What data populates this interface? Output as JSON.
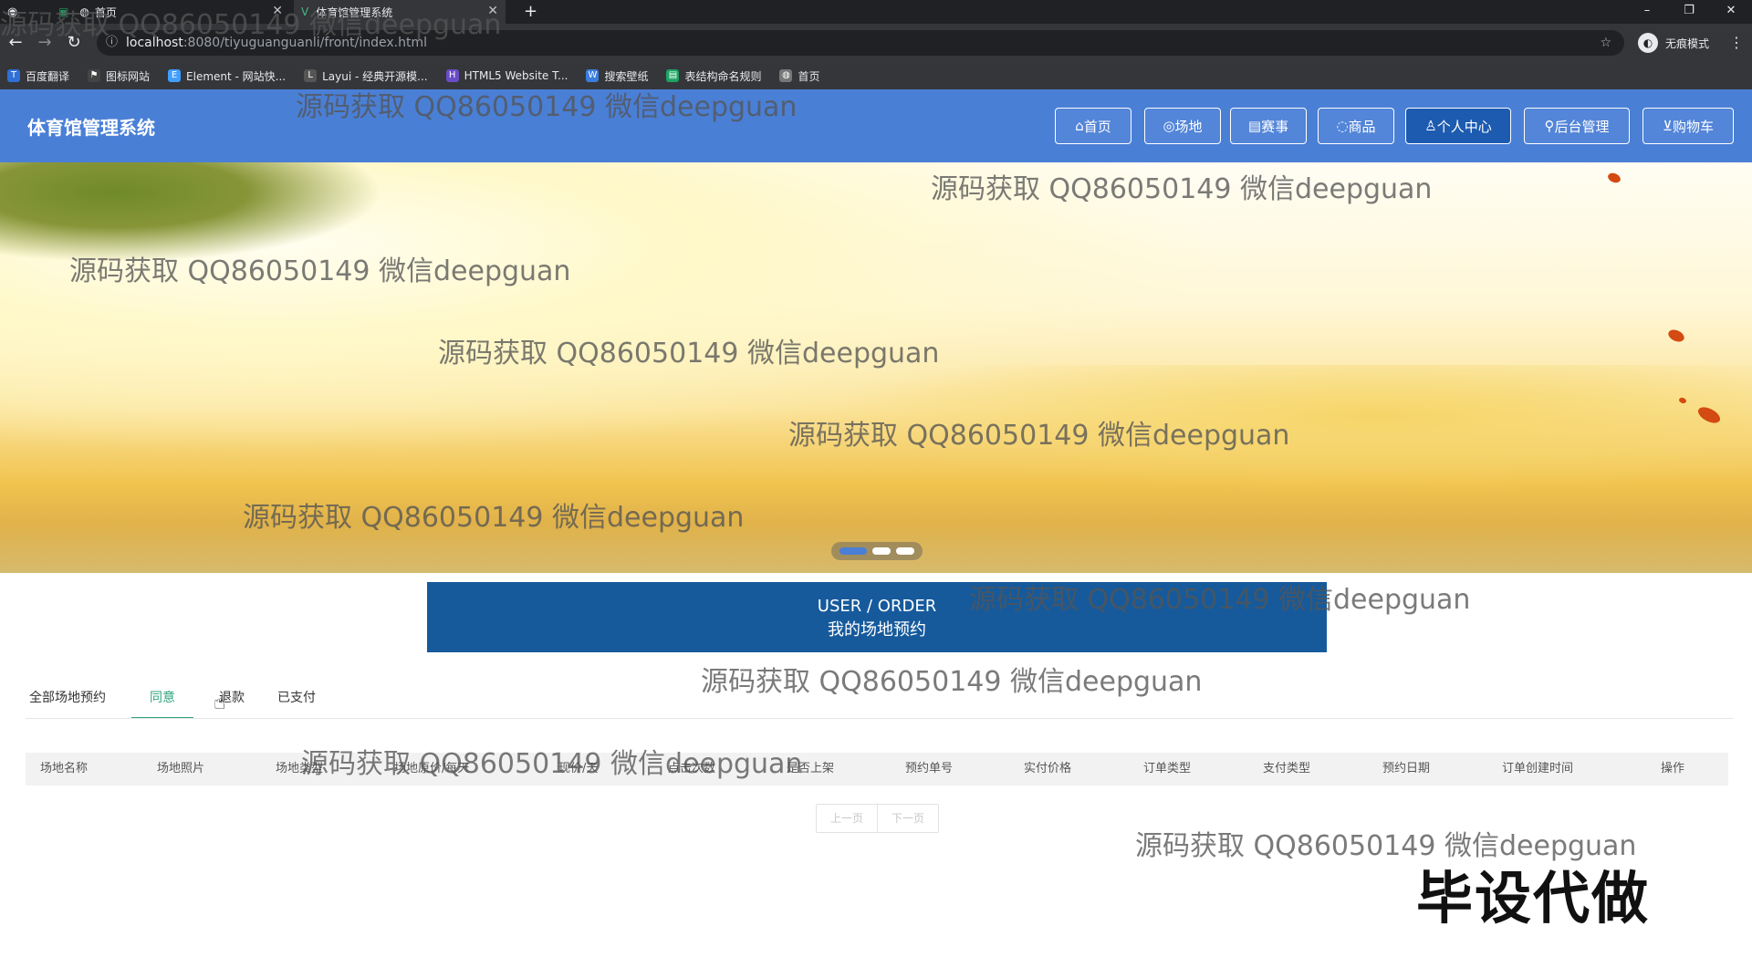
{
  "browser": {
    "tabs": [
      {
        "label": "",
        "icon": "browser-icon"
      },
      {
        "label": "首页",
        "icon": "sheet-icon"
      },
      {
        "label": "体育馆管理系统",
        "icon": "vue-icon"
      }
    ],
    "new_tab": "+",
    "window_controls": [
      "–",
      "❐",
      "✕"
    ],
    "url_host": "localhost",
    "url_rest": ":8080/tiyuguanguanli/front/index.html",
    "incognito_label": "无痕模式",
    "bookmarks": [
      {
        "label": "百度翻译",
        "color": "#2f6fd6"
      },
      {
        "label": "图标网站",
        "color": "#444444"
      },
      {
        "label": "Element - 网站快...",
        "color": "#409eff"
      },
      {
        "label": "Layui - 经典开源模...",
        "color": "#555555"
      },
      {
        "label": "HTML5 Website T...",
        "color": "#6a4cc7"
      },
      {
        "label": "搜索壁纸",
        "color": "#3b7ddd"
      },
      {
        "label": "表结构命名规则",
        "color": "#1ea362"
      },
      {
        "label": "首页",
        "color": "#777777"
      }
    ]
  },
  "header": {
    "title": "体育馆管理系统",
    "nav": [
      {
        "label": "首页",
        "icon": "home-icon",
        "glyph": "⌂"
      },
      {
        "label": "场地",
        "icon": "venue-icon",
        "glyph": "◎"
      },
      {
        "label": "赛事",
        "icon": "calendar-icon",
        "glyph": "▤"
      },
      {
        "label": "商品",
        "icon": "goods-icon",
        "glyph": "◌"
      },
      {
        "label": "个人中心",
        "icon": "user-icon",
        "glyph": "♙"
      },
      {
        "label": "后台管理",
        "icon": "link-icon",
        "glyph": "⚲"
      },
      {
        "label": "购物车",
        "icon": "cart-icon",
        "glyph": "⊻"
      }
    ],
    "active_nav": "个人中心"
  },
  "banner": {
    "slides": 3,
    "active_slide": 1
  },
  "section": {
    "title_en": "USER / ORDER",
    "title_cn": "我的场地预约"
  },
  "filter_tabs": [
    "全部场地预约",
    "同意",
    "退款",
    "已支付"
  ],
  "active_filter": "同意",
  "table": {
    "columns": [
      "场地名称",
      "场地照片",
      "场地类型",
      "场地原价/每天",
      "现价/天",
      "点击次数",
      "是否上架",
      "预约单号",
      "实付价格",
      "订单类型",
      "支付类型",
      "预约日期",
      "订单创建时间",
      "操作"
    ],
    "rows": []
  },
  "pagination": {
    "prev": "上一页",
    "next": "下一页"
  },
  "watermark": "源码获取 QQ86050149 微信deepguan",
  "stamp": "毕设代做",
  "colors": {
    "header": "#4a7fd6",
    "active_nav": "#1d5bb0",
    "section": "#165a9c",
    "tab_active": "#2fa57c"
  }
}
